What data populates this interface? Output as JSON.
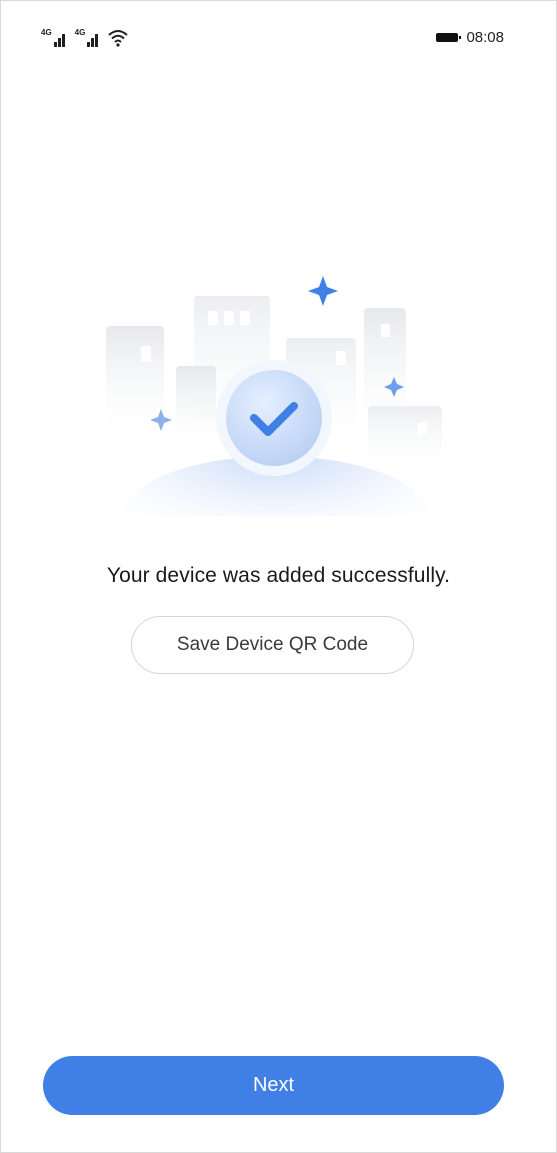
{
  "status_bar": {
    "signal_1_tag": "4G",
    "signal_2_tag": "4G",
    "time": "08:08"
  },
  "illustration": {
    "icon": "checkmark-icon",
    "accent_color": "#3f7fe6"
  },
  "message": "Your device was added successfully.",
  "save_qr_label": "Save Device QR Code",
  "next_label": "Next"
}
